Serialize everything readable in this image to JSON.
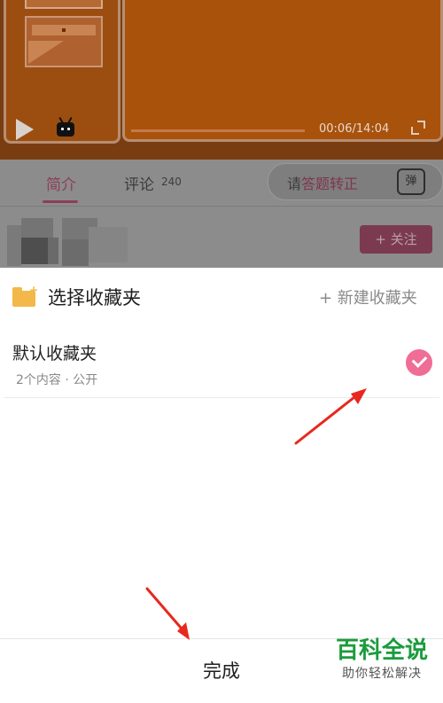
{
  "player": {
    "time": "00:06/14:04"
  },
  "tabs": {
    "intro": "简介",
    "comments": "评论",
    "comments_count": "240"
  },
  "danmaku": {
    "prefix": "请",
    "highlight": "答题转正",
    "button": "弹"
  },
  "follow": {
    "label": "+ 关注"
  },
  "sheet": {
    "title": "选择收藏夹",
    "new_folder": "+ 新建收藏夹",
    "folders": [
      {
        "name": "默认收藏夹",
        "meta": "2个内容 · 公开",
        "selected": true
      }
    ],
    "done": "完成"
  },
  "watermark": {
    "main": "百科全说",
    "sub": "助你轻松解决"
  },
  "colors": {
    "accent_pink": "#f06d95",
    "folder_yellow": "#f3b84a",
    "arrow_red": "#e8281e",
    "watermark_green": "#1a9b3c"
  }
}
